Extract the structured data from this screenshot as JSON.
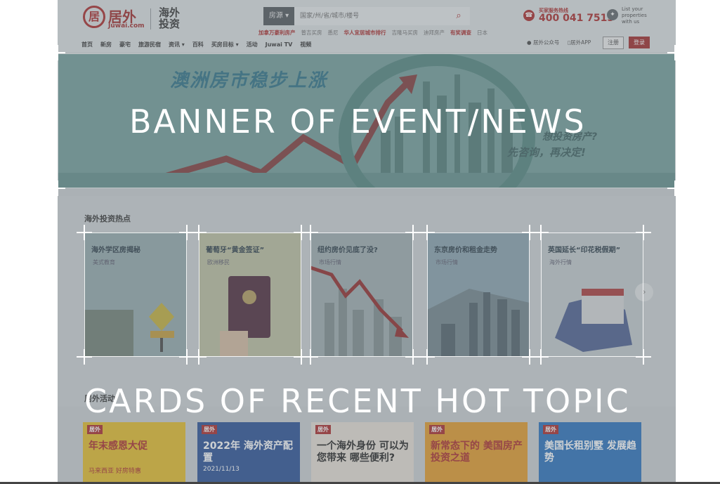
{
  "header": {
    "logo_mark": "居",
    "logo_name": "居外",
    "logo_sub": "Juwai.com",
    "logo_cn": "海外投资",
    "search_category": "房源 ▾",
    "search_placeholder": "国家/州/省/城市/楼号",
    "hot_links": [
      {
        "label": "加拿万豪利房产",
        "highlight": true
      },
      {
        "label": "普吉买房",
        "highlight": false
      },
      {
        "label": "悉尼",
        "highlight": false
      },
      {
        "label": "华人宜居城市排行",
        "highlight": true
      },
      {
        "label": "吉隆马买房",
        "highlight": false
      },
      {
        "label": "迪拜房产",
        "highlight": false
      },
      {
        "label": "有奖调查",
        "highlight": true
      },
      {
        "label": "日本",
        "highlight": false
      }
    ],
    "hotline_label": "买家服务热线",
    "hotline_number": "400 041 7515",
    "list_properties": "List your properties with us",
    "nav_items": [
      "首页",
      "新房",
      "豪宅",
      "旅游民宿",
      "资讯 ▾",
      "百科",
      "买房目标 ▾",
      "活动",
      "Juwai TV",
      "视频"
    ],
    "wechat": "居外公众号",
    "app": "居外APP",
    "register": "注册",
    "login": "登录"
  },
  "banner": {
    "headline": "澳洲房市稳步上涨",
    "sub": "先咨询，再决定!",
    "sub2": "想投资房产?"
  },
  "hot_section": {
    "title": "海外投资热点",
    "cards": [
      {
        "title": "海外学区房揭秘",
        "tag": "美式教育"
      },
      {
        "title": "葡萄牙“黄金签证”",
        "tag": "欧洲移民"
      },
      {
        "title": "纽约房价见底了没?",
        "tag": "市场行情"
      },
      {
        "title": "东京房价和租金走势",
        "tag": "市场行情"
      },
      {
        "title": "英国延长“印花税假期”",
        "tag": "海外行情"
      }
    ],
    "next_icon": "›"
  },
  "activities": {
    "title": "居外活动",
    "posters": [
      {
        "brand": "居外",
        "title": "年末感恩大促",
        "sub": "马来西亚 好房特惠",
        "color": "#e7c23a",
        "text_color": "#b03a3a"
      },
      {
        "brand": "居外",
        "title": "2022年 海外资产配置",
        "sub": "2021/11/13",
        "color": "#3a5e9e",
        "text_color": "#ffffff"
      },
      {
        "brand": "居外",
        "title": "一个海外身份 可以为您带来 哪些便利?",
        "sub": "",
        "color": "#e8e1d8",
        "text_color": "#333333"
      },
      {
        "brand": "居外",
        "title": "新常态下的 美国房产投资之道",
        "sub": "",
        "color": "#e6a33a",
        "text_color": "#b03a3a"
      },
      {
        "brand": "居外",
        "title": "美国长租别墅 发展趋势",
        "sub": "",
        "color": "#3a7cc2",
        "text_color": "#ffffff"
      }
    ]
  },
  "annotations": {
    "banner": "BANNER OF EVENT/NEWS",
    "cards": "CARDS OF RECENT HOT TOPIC"
  },
  "colors": {
    "brand_red": "#b03a3a",
    "overlay": "#5a6469"
  }
}
